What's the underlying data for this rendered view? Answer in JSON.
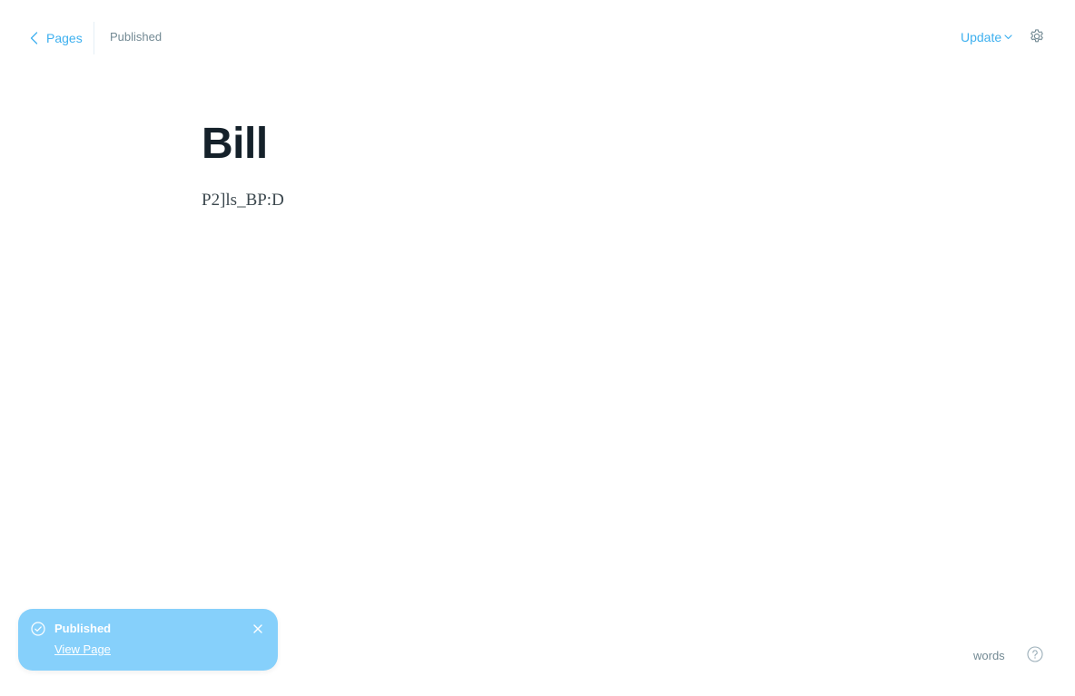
{
  "header": {
    "back_label": "Pages",
    "status": "Published",
    "update_label": "Update"
  },
  "editor": {
    "title": "Bill",
    "body": "P2]ls_BP:D"
  },
  "toast": {
    "title": "Published",
    "link": "View Page"
  },
  "footer": {
    "word_count_label": "words"
  },
  "colors": {
    "accent": "#3eb0ef",
    "muted": "#738a94",
    "toast_bg": "#86d0fb",
    "title": "#15212a"
  },
  "icons": {
    "back": "chevron-left-icon",
    "update_dropdown": "chevron-down-icon",
    "settings": "gear-icon",
    "toast_status": "check-circle-icon",
    "toast_close": "close-icon",
    "help": "question-circle-icon"
  }
}
